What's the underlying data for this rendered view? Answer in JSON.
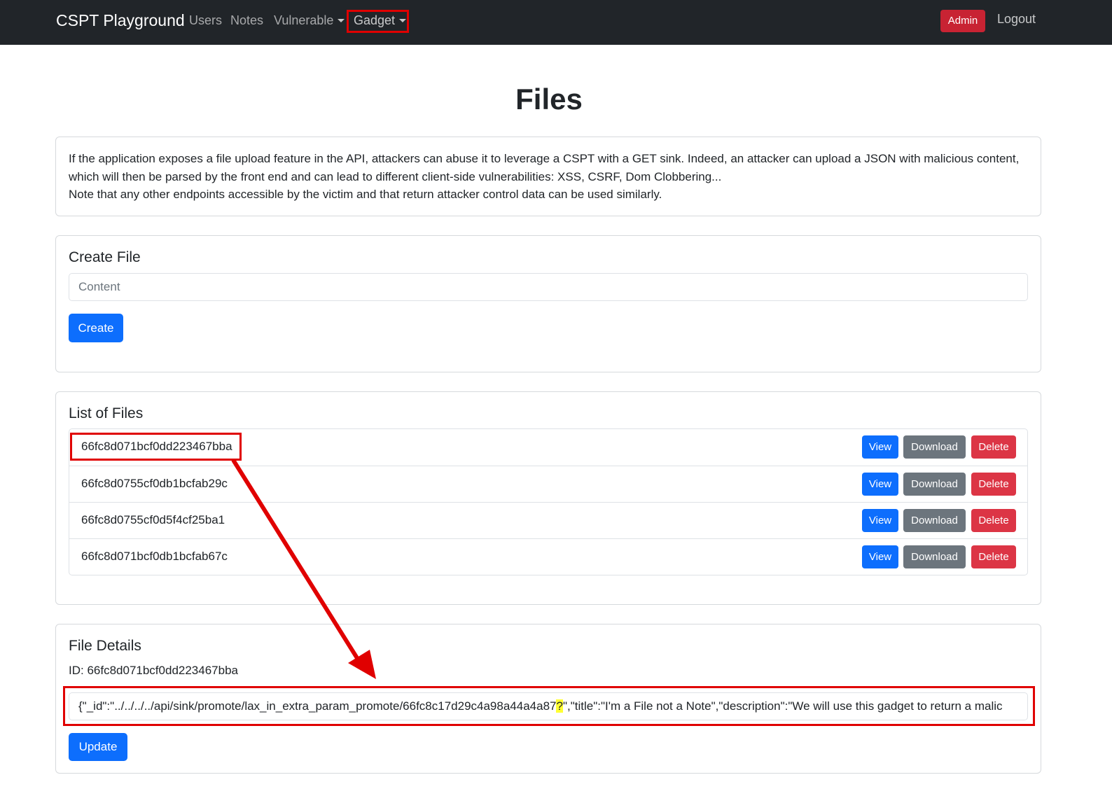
{
  "navbar": {
    "brand": "CSPT Playground",
    "links": [
      "Users",
      "Notes"
    ],
    "vulnerable_label": "Vulnerable",
    "gadget_label": "Gadget",
    "admin_label": "Admin",
    "logout_label": "Logout"
  },
  "page": {
    "title": "Files"
  },
  "description": {
    "line1": "If the application exposes a file upload feature in the API, attackers can abuse it to leverage a CSPT with a GET sink. Indeed, an attacker can upload a JSON with malicious content, which will then be parsed by the front end and can lead to different client-side vulnerabilities: XSS, CSRF, Dom Clobbering...",
    "line2": "Note that any other endpoints accessible by the victim and that return attacker control data can be used similarly."
  },
  "create_file": {
    "title": "Create File",
    "placeholder": "Content",
    "button_label": "Create"
  },
  "file_list": {
    "title": "List of Files",
    "view_label": "View",
    "download_label": "Download",
    "delete_label": "Delete",
    "files": [
      "66fc8d071bcf0dd223467bba",
      "66fc8d0755cf0db1bcfab29c",
      "66fc8d0755cf0d5f4cf25ba1",
      "66fc8d071bcf0db1bcfab67c"
    ]
  },
  "file_details": {
    "title": "File Details",
    "id_label": "ID: 66fc8d071bcf0dd223467bba",
    "content_before": "{\"_id\":\"../../../../api/sink/promote/lax_in_extra_param_promote/66fc8c17d29c4a98a44a4a87",
    "content_highlight": "?",
    "content_after": "\",\"title\":\"I'm a File not a Note\",\"description\":\"We will use this gadget to return a malic",
    "button_label": "Update"
  },
  "colors": {
    "navbar": "#212529",
    "primary": "#0d6efd",
    "secondary": "#6c757d",
    "danger": "#dc3545",
    "annotation": "#e00000",
    "highlight": "#ffff33"
  }
}
